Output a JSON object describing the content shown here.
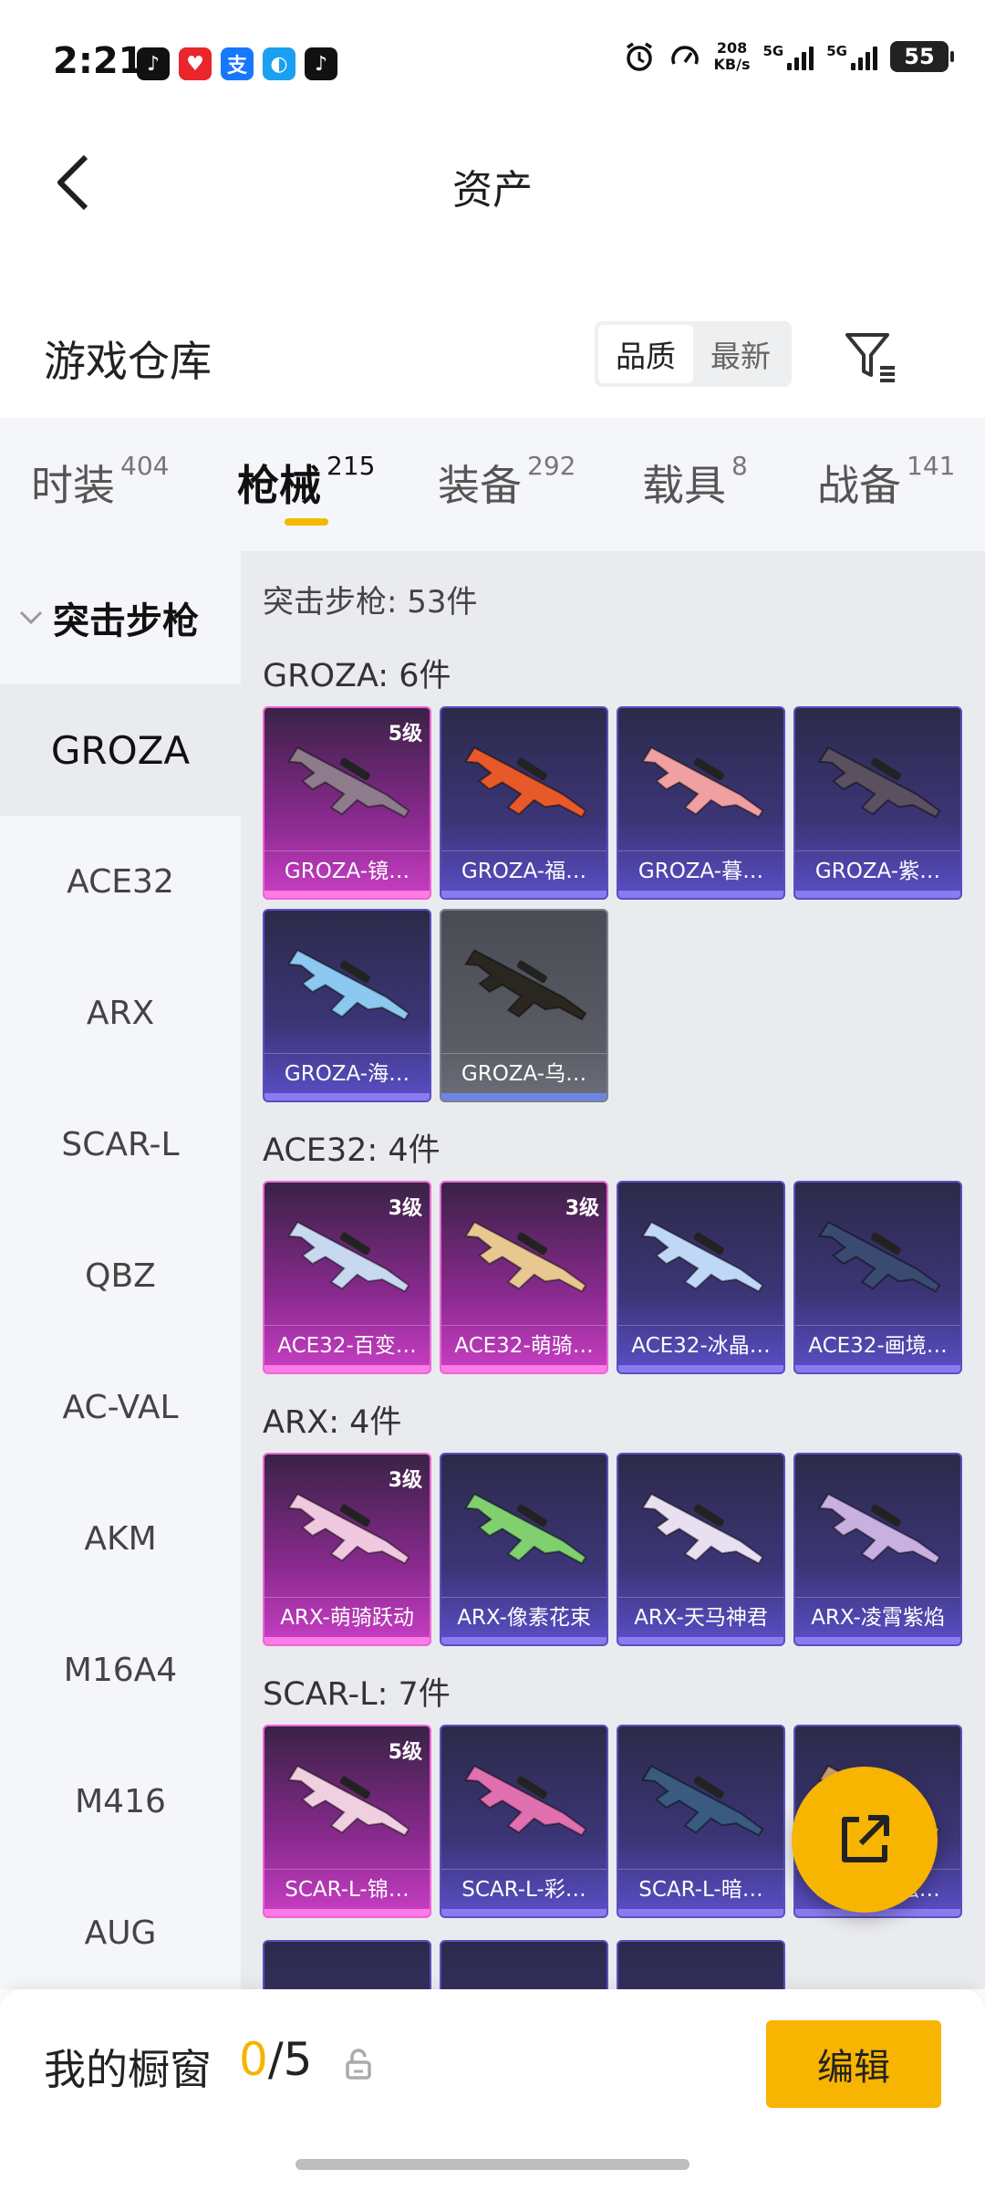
{
  "status_bar": {
    "time": "2:21",
    "apps": [
      {
        "icon": "tiktok-icon",
        "glyph": "♪",
        "color": "#111111"
      },
      {
        "icon": "heart-app-icon",
        "glyph": "♥",
        "color": "#e8262c"
      },
      {
        "icon": "alipay-icon",
        "glyph": "支",
        "color": "#1677ff"
      },
      {
        "icon": "bird-app-icon",
        "glyph": "◐",
        "color": "#1aa0f0"
      },
      {
        "icon": "tiktok-icon",
        "glyph": "♪",
        "color": "#111111"
      }
    ],
    "speed_value": "208",
    "speed_unit": "KB/s",
    "net1": "5G",
    "net2": "5G",
    "battery": "55"
  },
  "header": {
    "title": "资产"
  },
  "warehouse": {
    "title": "游戏仓库",
    "sort_options": [
      "品质",
      "最新"
    ],
    "sort_active": 0
  },
  "tabs": [
    {
      "label": "时装",
      "count": "404"
    },
    {
      "label": "枪械",
      "count": "215",
      "active": true
    },
    {
      "label": "装备",
      "count": "292"
    },
    {
      "label": "载具",
      "count": "8"
    },
    {
      "label": "战备",
      "count": "141"
    }
  ],
  "sidebar": {
    "category": "突击步枪",
    "items": [
      "GROZA",
      "ACE32",
      "ARX",
      "SCAR-L",
      "QBZ",
      "AC-VAL",
      "AKM",
      "M16A4",
      "M416",
      "AUG"
    ],
    "active_index": 0
  },
  "content": {
    "summary": "突击步枪: 53件",
    "groups": [
      {
        "title": "GROZA: 6件",
        "items": [
          {
            "name": "GROZA-镜…",
            "level": "5级",
            "quality": "q5",
            "gun_color": "#8e7c8c"
          },
          {
            "name": "GROZA-福…",
            "level": "",
            "quality": "purple",
            "gun_color": "#e8592a"
          },
          {
            "name": "GROZA-暮…",
            "level": "",
            "quality": "purple",
            "gun_color": "#f0a0a0"
          },
          {
            "name": "GROZA-紫…",
            "level": "",
            "quality": "purple",
            "gun_color": "#5a5060"
          },
          {
            "name": "GROZA-海…",
            "level": "",
            "quality": "purple",
            "gun_color": "#8cc8f0"
          },
          {
            "name": "GROZA-乌…",
            "level": "",
            "quality": "gray",
            "gun_color": "#2a2620"
          }
        ]
      },
      {
        "title": "ACE32: 4件",
        "items": [
          {
            "name": "ACE32-百变…",
            "level": "3级",
            "quality": "q3",
            "gun_color": "#c8d8f0"
          },
          {
            "name": "ACE32-萌骑…",
            "level": "3级",
            "quality": "q3",
            "gun_color": "#e8c890"
          },
          {
            "name": "ACE32-冰晶…",
            "level": "",
            "quality": "purple",
            "gun_color": "#c0d8f8"
          },
          {
            "name": "ACE32-画境…",
            "level": "",
            "quality": "purple",
            "gun_color": "#3a4a70"
          }
        ]
      },
      {
        "title": "ARX: 4件",
        "items": [
          {
            "name": "ARX-萌骑跃动",
            "level": "3级",
            "quality": "q3",
            "gun_color": "#f0c8e0"
          },
          {
            "name": "ARX-像素花束",
            "level": "",
            "quality": "purple",
            "gun_color": "#80d070"
          },
          {
            "name": "ARX-天马神君",
            "level": "",
            "quality": "purple",
            "gun_color": "#e8e0f0"
          },
          {
            "name": "ARX-凌霄紫焰",
            "level": "",
            "quality": "purple",
            "gun_color": "#c8b0e0"
          }
        ]
      },
      {
        "title": "SCAR-L: 7件",
        "items": [
          {
            "name": "SCAR-L-锦…",
            "level": "5级",
            "quality": "q5",
            "gun_color": "#f0d0e0"
          },
          {
            "name": "SCAR-L-彩…",
            "level": "",
            "quality": "purple",
            "gun_color": "#e070b0"
          },
          {
            "name": "SCAR-L-暗…",
            "level": "",
            "quality": "purple",
            "gun_color": "#3a5a80"
          },
          {
            "name": "SCAR-L-炫…",
            "level": "",
            "quality": "purple",
            "gun_color": "#c8a070"
          }
        ]
      }
    ]
  },
  "showcase": {
    "label": "我的橱窗",
    "current": "0",
    "total": "/5",
    "edit_label": "编辑"
  },
  "colors": {
    "accent": "#f7b400",
    "tab_underline": "#f5b800"
  }
}
